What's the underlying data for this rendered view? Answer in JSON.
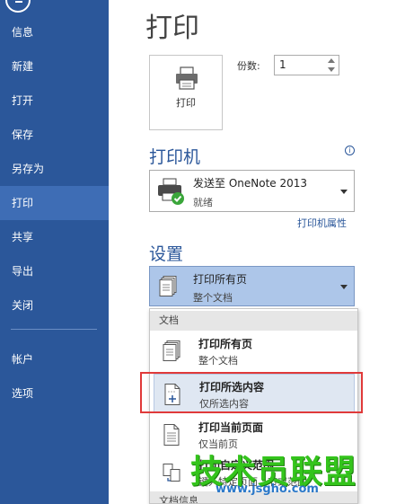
{
  "sidebar": {
    "items": [
      {
        "label": "信息"
      },
      {
        "label": "新建"
      },
      {
        "label": "打开"
      },
      {
        "label": "保存"
      },
      {
        "label": "另存为"
      },
      {
        "label": "打印",
        "active": true
      },
      {
        "label": "共享"
      },
      {
        "label": "导出"
      },
      {
        "label": "关闭"
      },
      {
        "label": "帐户"
      },
      {
        "label": "选项"
      }
    ]
  },
  "main": {
    "title": "打印",
    "print_button_label": "打印",
    "copies_label": "份数:",
    "copies_value": "1",
    "printer_heading": "打印机",
    "printer_name": "发送至 OneNote 2013",
    "printer_status": "就绪",
    "printer_props_link": "打印机属性",
    "settings_heading": "设置",
    "range_selected_title": "打印所有页",
    "range_selected_sub": "整个文档"
  },
  "dropdown": {
    "header_document": "文档",
    "items": [
      {
        "title": "打印所有页",
        "sub": "整个文档"
      },
      {
        "title": "打印所选内容",
        "sub": "仅所选内容"
      },
      {
        "title": "打印当前页面",
        "sub": "仅当前页"
      },
      {
        "title": "打印自定义范围",
        "sub": "键入特定页面、节或范围"
      }
    ],
    "header_info": "文档信息"
  },
  "watermark": {
    "text": "技术员联盟",
    "url": "www.jsgho.com"
  },
  "colors": {
    "sidebar_bg": "#2b579a",
    "sidebar_active": "#3e6db5",
    "accent": "#2b579a",
    "highlight_outline": "#e03a3a",
    "watermark_green": "#34c41c"
  }
}
